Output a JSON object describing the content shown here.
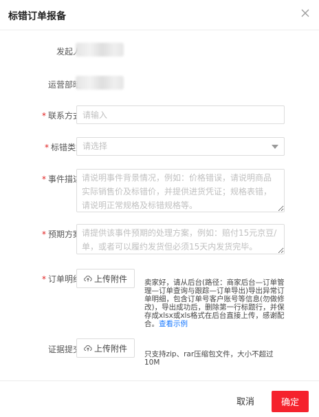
{
  "dialog": {
    "title": "标错订单报备"
  },
  "form": {
    "initiator": {
      "label": "发起人:"
    },
    "department": {
      "label": "运营部暗:"
    },
    "contact": {
      "label": "联系方式:",
      "placeholder": "请输入",
      "required": true
    },
    "error_type": {
      "label": "标错类型",
      "placeholder": "请选择",
      "required": true
    },
    "event_desc": {
      "label": "事件描述:",
      "placeholder": "请说明事件背景情况，例如：价格错误，请说明商品实际销售价及标错价，并提供进货凭证；规格表错，请说明正常规格及标错规格等。",
      "required": true
    },
    "plan": {
      "label": "预期方案:",
      "placeholder": "请提供该事件预期的处理方案，例如：赔付15元京豆/单，或者可以履约发货但必须15天内发货完毕。",
      "required": true
    },
    "order_detail": {
      "label": "订单明细:",
      "required": true,
      "upload_label": "上传附件",
      "note": "卖家好，请从后台(路径：商家后台—订单管理—订单查询与跟踪—订单导出)导出异常订单明细，包含订单号客户账号等信息(勿做修改)，导出成功后，删除第一行标题行，并保存成xlsx或xls格式在后台直接上传，感谢配合。",
      "note_link": "查看示例"
    },
    "evidence": {
      "label": "证据提交:",
      "upload_label": "上传附件",
      "note": "只支持zip、rar压缩包文件，大小不超过10M"
    }
  },
  "footer": {
    "cancel_label": "取消",
    "confirm_label": "确定"
  },
  "colors": {
    "required": "#e02020",
    "primary": "#f5222d",
    "link": "#1677ff"
  },
  "icons": {
    "close": "close-icon",
    "upload": "cloud-upload-icon",
    "dropdown": "caret-down-icon"
  }
}
